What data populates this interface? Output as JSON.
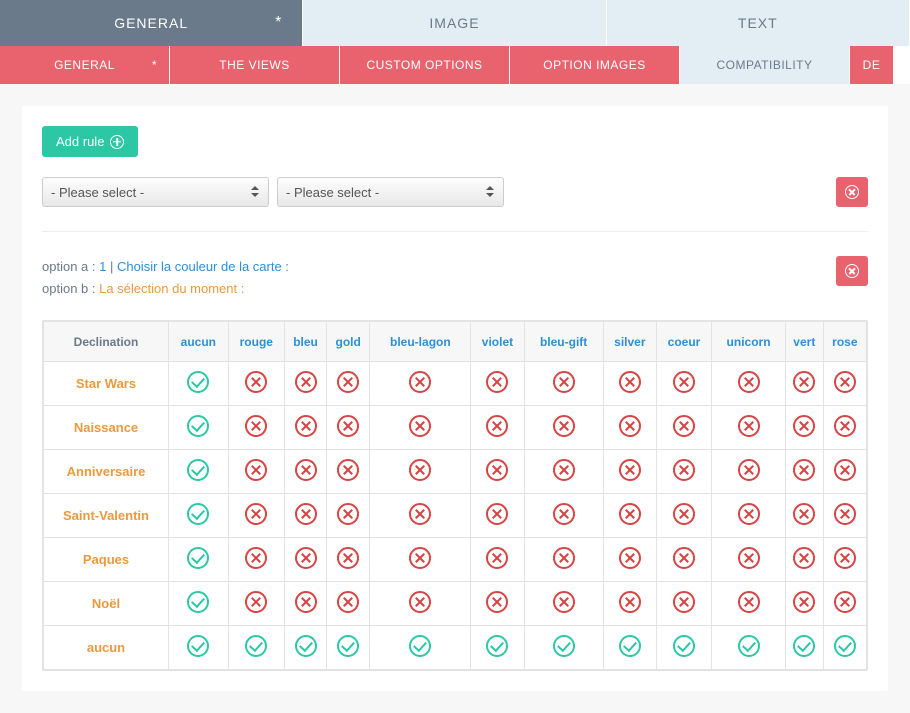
{
  "top_tabs": [
    {
      "label": "GENERAL",
      "marked": true,
      "active": true
    },
    {
      "label": "IMAGE",
      "marked": false,
      "active": false
    },
    {
      "label": "TEXT",
      "marked": false,
      "active": false
    }
  ],
  "sub_tabs": [
    {
      "label": "GENERAL",
      "marked": true,
      "active": false
    },
    {
      "label": "THE VIEWS",
      "marked": false,
      "active": false
    },
    {
      "label": "CUSTOM OPTIONS",
      "marked": false,
      "active": false
    },
    {
      "label": "OPTION IMAGES",
      "marked": false,
      "active": false
    },
    {
      "label": "COMPATIBILITY",
      "marked": false,
      "active": true
    },
    {
      "label": "DE",
      "marked": false,
      "active": false,
      "truncated": true
    }
  ],
  "buttons": {
    "add_rule": "Add rule"
  },
  "selects": {
    "placeholder": "- Please select -"
  },
  "option_info": {
    "a_prefix": "option a : ",
    "a_num": "1",
    "a_sep": " | ",
    "a_link": "Choisir la couleur de la carte :",
    "b_prefix": "option b : ",
    "b_text": "La sélection du moment :"
  },
  "grid": {
    "corner": "Declination",
    "columns": [
      "aucun",
      "rouge",
      "bleu",
      "gold",
      "bleu-lagon",
      "violet",
      "bleu-gift",
      "silver",
      "coeur",
      "unicorn",
      "vert",
      "rose"
    ],
    "rows": [
      {
        "name": "Star Wars",
        "cells": [
          "ok",
          "no",
          "no",
          "no",
          "no",
          "no",
          "no",
          "no",
          "no",
          "no",
          "no",
          "no"
        ]
      },
      {
        "name": "Naissance",
        "cells": [
          "ok",
          "no",
          "no",
          "no",
          "no",
          "no",
          "no",
          "no",
          "no",
          "no",
          "no",
          "no"
        ]
      },
      {
        "name": "Anniversaire",
        "cells": [
          "ok",
          "no",
          "no",
          "no",
          "no",
          "no",
          "no",
          "no",
          "no",
          "no",
          "no",
          "no"
        ]
      },
      {
        "name": "Saint-Valentin",
        "cells": [
          "ok",
          "no",
          "no",
          "no",
          "no",
          "no",
          "no",
          "no",
          "no",
          "no",
          "no",
          "no"
        ]
      },
      {
        "name": "Paques",
        "cells": [
          "ok",
          "no",
          "no",
          "no",
          "no",
          "no",
          "no",
          "no",
          "no",
          "no",
          "no",
          "no"
        ]
      },
      {
        "name": "Noël",
        "cells": [
          "ok",
          "no",
          "no",
          "no",
          "no",
          "no",
          "no",
          "no",
          "no",
          "no",
          "no",
          "no"
        ]
      },
      {
        "name": "aucun",
        "cells": [
          "ok",
          "ok",
          "ok",
          "ok",
          "ok",
          "ok",
          "ok",
          "ok",
          "ok",
          "ok",
          "ok",
          "ok"
        ]
      }
    ]
  }
}
